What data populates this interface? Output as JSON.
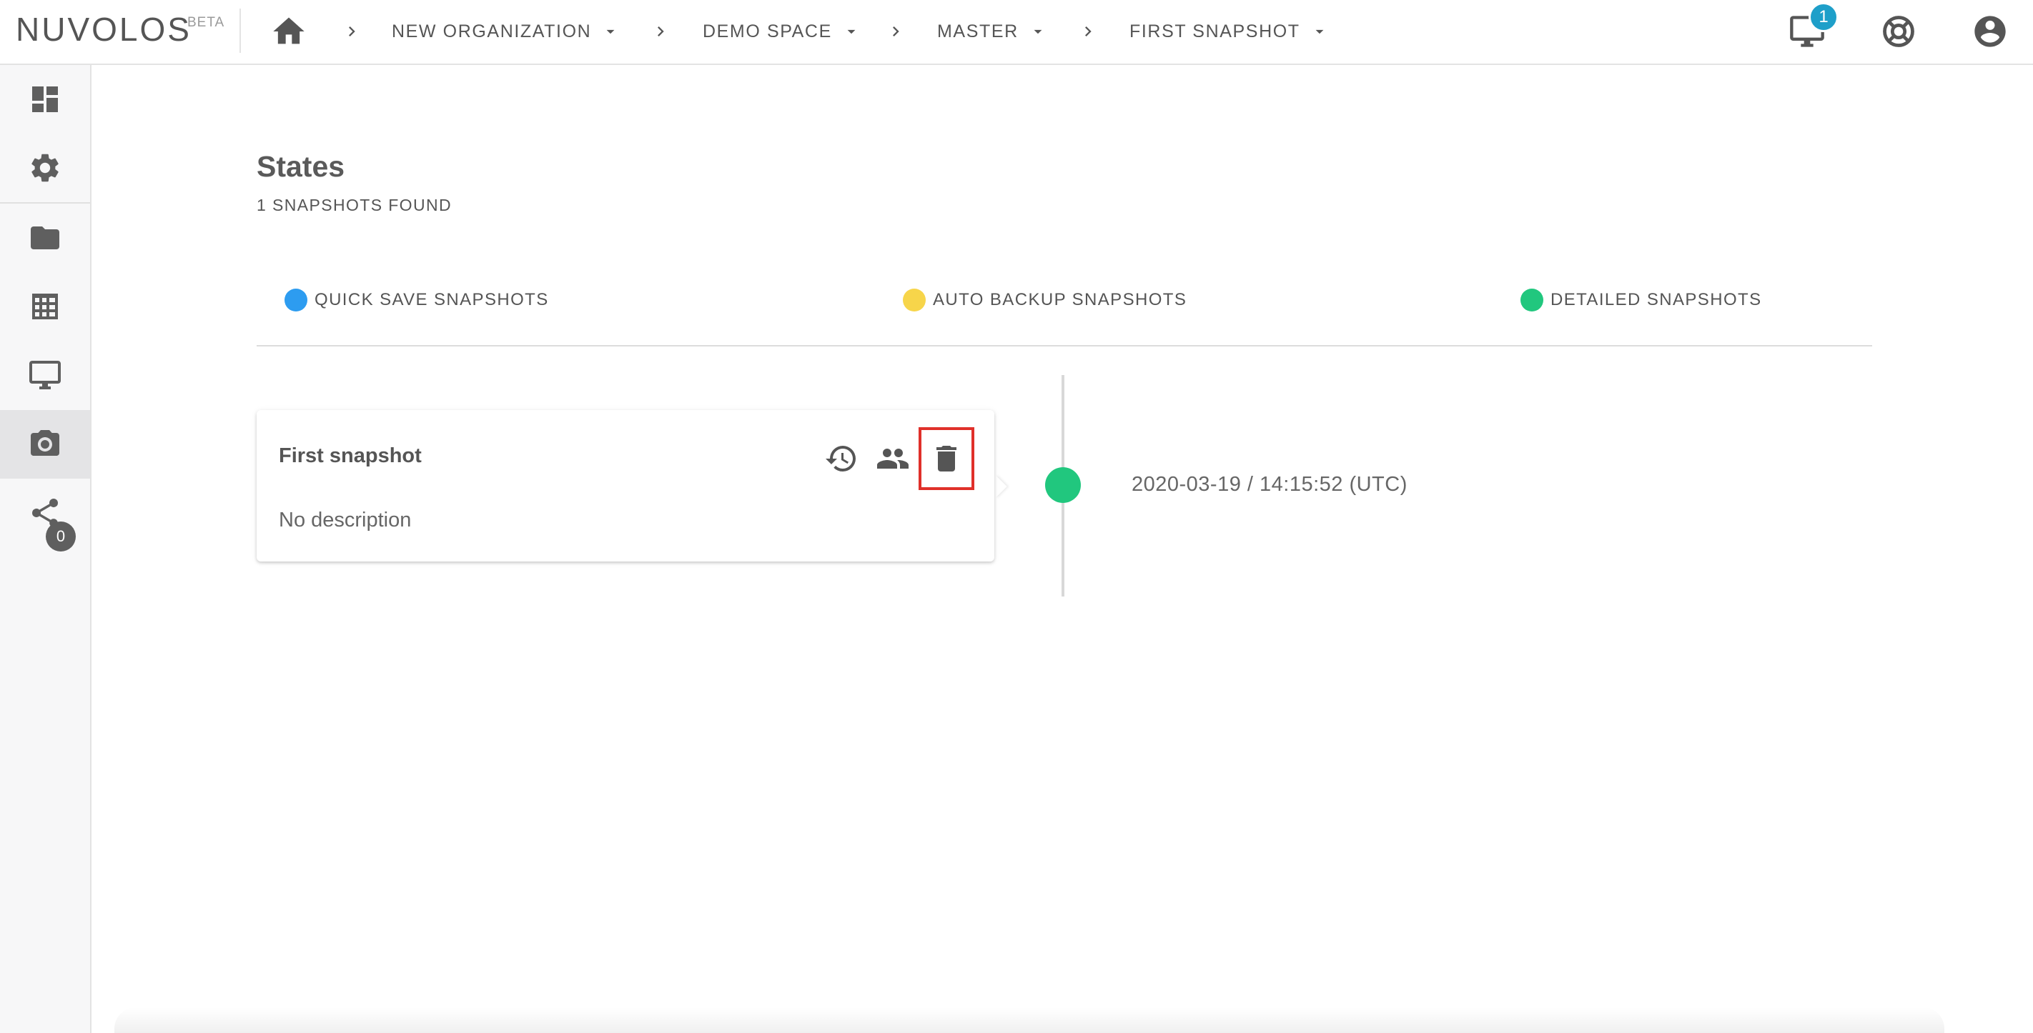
{
  "brand": {
    "name": "NUVOLOS",
    "tag": "BETA"
  },
  "breadcrumb": [
    {
      "label": "NEW ORGANIZATION"
    },
    {
      "label": "DEMO SPACE"
    },
    {
      "label": "MASTER"
    },
    {
      "label": "FIRST SNAPSHOT"
    }
  ],
  "topbar": {
    "notifications_count": "1"
  },
  "sidebar": {
    "items": [
      "dashboard",
      "settings",
      "files",
      "tables",
      "applications",
      "snapshots",
      "share"
    ],
    "active": "snapshots",
    "share_count": "0"
  },
  "page": {
    "title": "States",
    "subtitle": "1 SNAPSHOTS FOUND"
  },
  "legend": [
    {
      "label": "QUICK SAVE SNAPSHOTS",
      "color": "#2d9cf0"
    },
    {
      "label": "AUTO BACKUP SNAPSHOTS",
      "color": "#f7d54a"
    },
    {
      "label": "DETAILED SNAPSHOTS",
      "color": "#21c77e"
    }
  ],
  "snapshot": {
    "name": "First snapshot",
    "description": "No description",
    "timestamp": "2020-03-19 / 14:15:52 (UTC)",
    "type_color": "#21c77e"
  },
  "colors": {
    "accent": "#1e9fc9",
    "highlight": "#e0302a"
  }
}
